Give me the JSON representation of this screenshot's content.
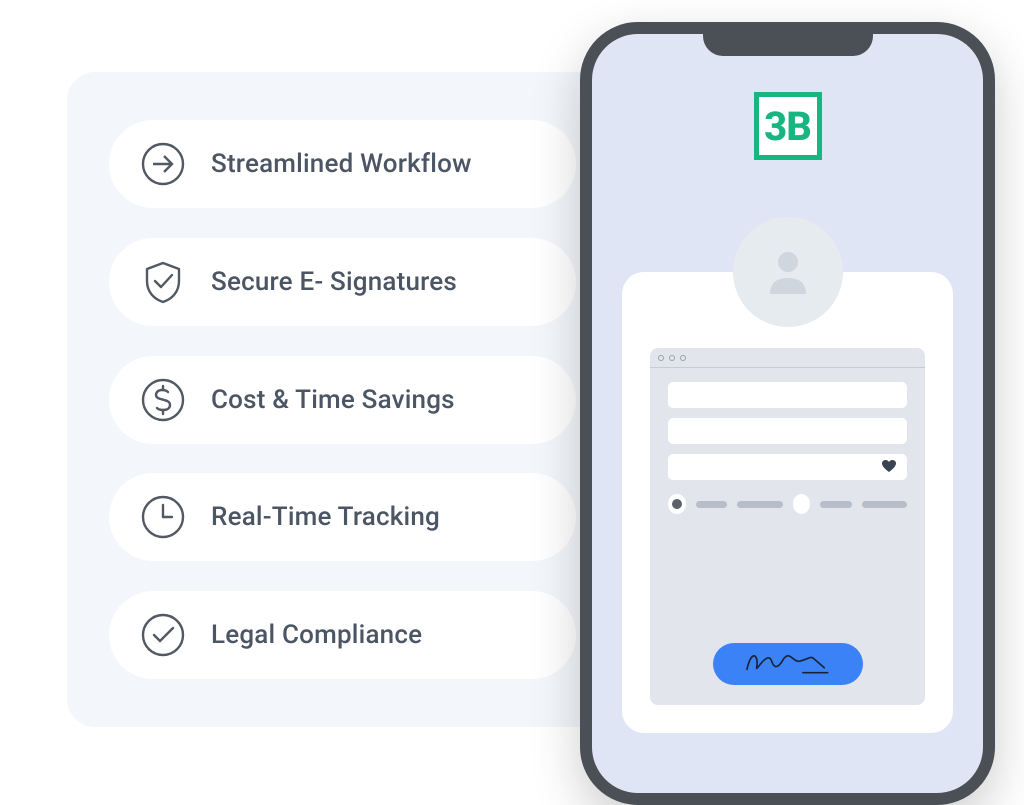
{
  "features": {
    "items": [
      {
        "label": "Streamlined Workflow",
        "icon": "arrow-right-icon"
      },
      {
        "label": "Secure E- Signatures",
        "icon": "shield-check-icon"
      },
      {
        "label": "Cost & Time Savings",
        "icon": "dollar-icon"
      },
      {
        "label": "Real-Time Tracking",
        "icon": "clock-icon"
      },
      {
        "label": "Legal Compliance",
        "icon": "check-circle-icon"
      }
    ]
  },
  "phone": {
    "logo_text": "3B",
    "colors": {
      "accent": "#17b681",
      "button": "#3b82f6"
    }
  }
}
